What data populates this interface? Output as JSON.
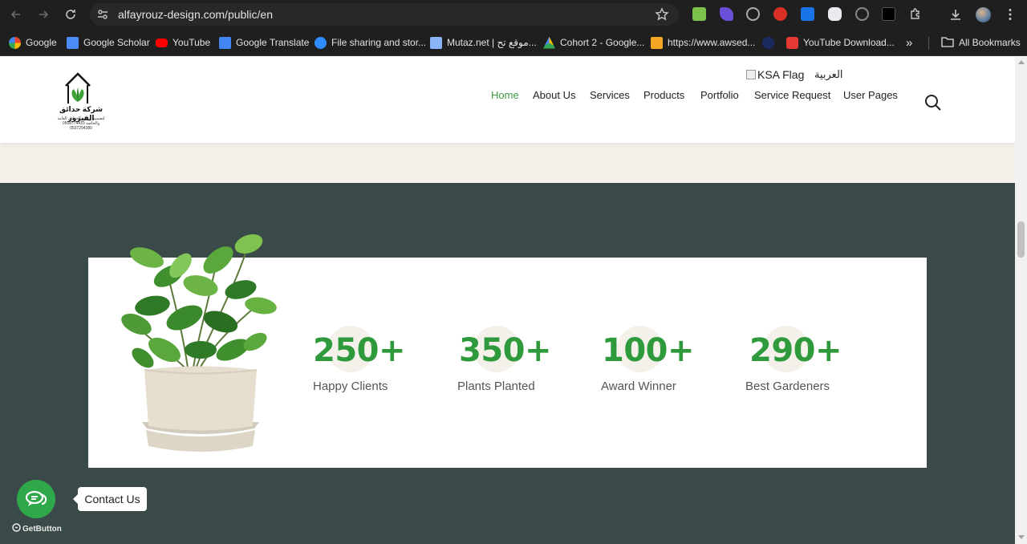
{
  "browser": {
    "url": "alfayrouz-design.com/public/en",
    "bookmarks": [
      {
        "label": "Google",
        "color": "#4285f4"
      },
      {
        "label": "Google Scholar",
        "color": "#4c8bf5"
      },
      {
        "label": "YouTube",
        "color": "#ff0000"
      },
      {
        "label": "Google Translate",
        "color": "#4285f4"
      },
      {
        "label": "File sharing and stor...",
        "color": "#2d8cff"
      },
      {
        "label": "Mutaz.net | موقع تح...",
        "color": "#8ab4f8"
      },
      {
        "label": "Cohort 2 - Google...",
        "color": "#fbbc04"
      },
      {
        "label": "https://www.awsed...",
        "color": "#f5a623"
      },
      {
        "label": "",
        "color": "#1a2a5e"
      },
      {
        "label": "YouTube Download...",
        "color": "#e53935"
      }
    ],
    "overflow_label": "»",
    "all_bookmarks_label": "All Bookmarks"
  },
  "header": {
    "logo": {
      "name": "شركة حدائق الفيروز",
      "tagline": "لتصميم وتنفيذ الحدائق العامة والخاصة",
      "phone1": "0508774410",
      "phone2": "0537294380"
    },
    "nav": [
      {
        "label": "Home",
        "active": true
      },
      {
        "label": "About Us",
        "active": false
      },
      {
        "label": "Services",
        "active": false
      },
      {
        "label": "Products",
        "active": false
      },
      {
        "label": "Portfolio",
        "active": false
      },
      {
        "label": "Service Request",
        "active": false
      },
      {
        "label": "User Pages",
        "active": false
      }
    ],
    "lang": {
      "flag_alt": "KSA Flag",
      "label": "العربية"
    }
  },
  "stats": [
    {
      "value": "250+",
      "label": "Happy Clients"
    },
    {
      "value": "350+",
      "label": "Plants Planted"
    },
    {
      "value": "100+",
      "label": "Award Winner"
    },
    {
      "value": "290+",
      "label": "Best Gardeners"
    }
  ],
  "contact": {
    "label": "Contact Us",
    "brand": "GetButton"
  },
  "colors": {
    "accent_green": "#2f9a3c",
    "dark_section": "#3a4a48",
    "cream": "#f4f1ea"
  }
}
